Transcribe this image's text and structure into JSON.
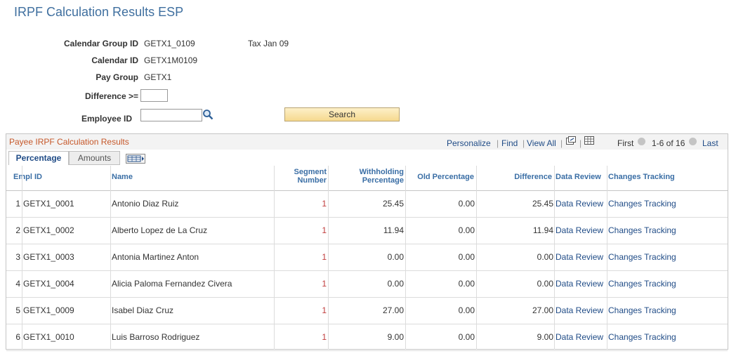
{
  "page": {
    "title": "IRPF Calculation Results ESP"
  },
  "form": {
    "calendar_group_label": "Calendar Group ID",
    "calendar_group_value": "GETX1_0109",
    "calendar_group_desc": "Tax Jan 09",
    "calendar_id_label": "Calendar ID",
    "calendar_id_value": "GETX1M0109",
    "pay_group_label": "Pay Group",
    "pay_group_value": "GETX1",
    "difference_label": "Difference >=",
    "difference_value": "",
    "employee_id_label": "Employee ID",
    "employee_id_value": "",
    "search_label": "Search"
  },
  "grid": {
    "title": "Payee IRPF Calculation Results",
    "nav": {
      "personalize": "Personalize",
      "find": "Find",
      "view_all": "View All",
      "first": "First",
      "range": "1-6 of 16",
      "last": "Last"
    },
    "tabs": [
      "Percentage",
      "Amounts"
    ],
    "columns": {
      "empl_id": "Empl ID",
      "name": "Name",
      "segment_1": "Segment",
      "segment_2": "Number",
      "withholding_1": "Withholding",
      "withholding_2": "Percentage",
      "old_percentage": "Old Percentage",
      "difference": "Difference",
      "data_review": "Data Review",
      "changes_tracking": "Changes Tracking"
    },
    "rows": [
      {
        "n": "1",
        "empl_id": "GETX1_0001",
        "name": "Antonio Diaz Ruiz",
        "segment": "1",
        "withholding": "25.45",
        "old": "0.00",
        "diff": "25.45",
        "review": "Data Review",
        "tracking": "Changes Tracking"
      },
      {
        "n": "2",
        "empl_id": "GETX1_0002",
        "name": "Alberto Lopez de La Cruz",
        "segment": "1",
        "withholding": "11.94",
        "old": "0.00",
        "diff": "11.94",
        "review": "Data Review",
        "tracking": "Changes Tracking"
      },
      {
        "n": "3",
        "empl_id": "GETX1_0003",
        "name": "Antonia Martinez Anton",
        "segment": "1",
        "withholding": "0.00",
        "old": "0.00",
        "diff": "0.00",
        "review": "Data Review",
        "tracking": "Changes Tracking"
      },
      {
        "n": "4",
        "empl_id": "GETX1_0004",
        "name": "Alicia Paloma Fernandez Civera",
        "segment": "1",
        "withholding": "0.00",
        "old": "0.00",
        "diff": "0.00",
        "review": "Data Review",
        "tracking": "Changes Tracking"
      },
      {
        "n": "5",
        "empl_id": "GETX1_0009",
        "name": "Isabel Diaz Cruz",
        "segment": "1",
        "withholding": "27.00",
        "old": "0.00",
        "diff": "27.00",
        "review": "Data Review",
        "tracking": "Changes Tracking"
      },
      {
        "n": "6",
        "empl_id": "GETX1_0010",
        "name": "Luis Barroso Rodriguez",
        "segment": "1",
        "withholding": "9.00",
        "old": "0.00",
        "diff": "9.00",
        "review": "Data Review",
        "tracking": "Changes Tracking"
      }
    ]
  },
  "colors": {
    "link": "#1f4b86",
    "grid_title": "#c6582a",
    "page_title": "#3f6f9f"
  }
}
